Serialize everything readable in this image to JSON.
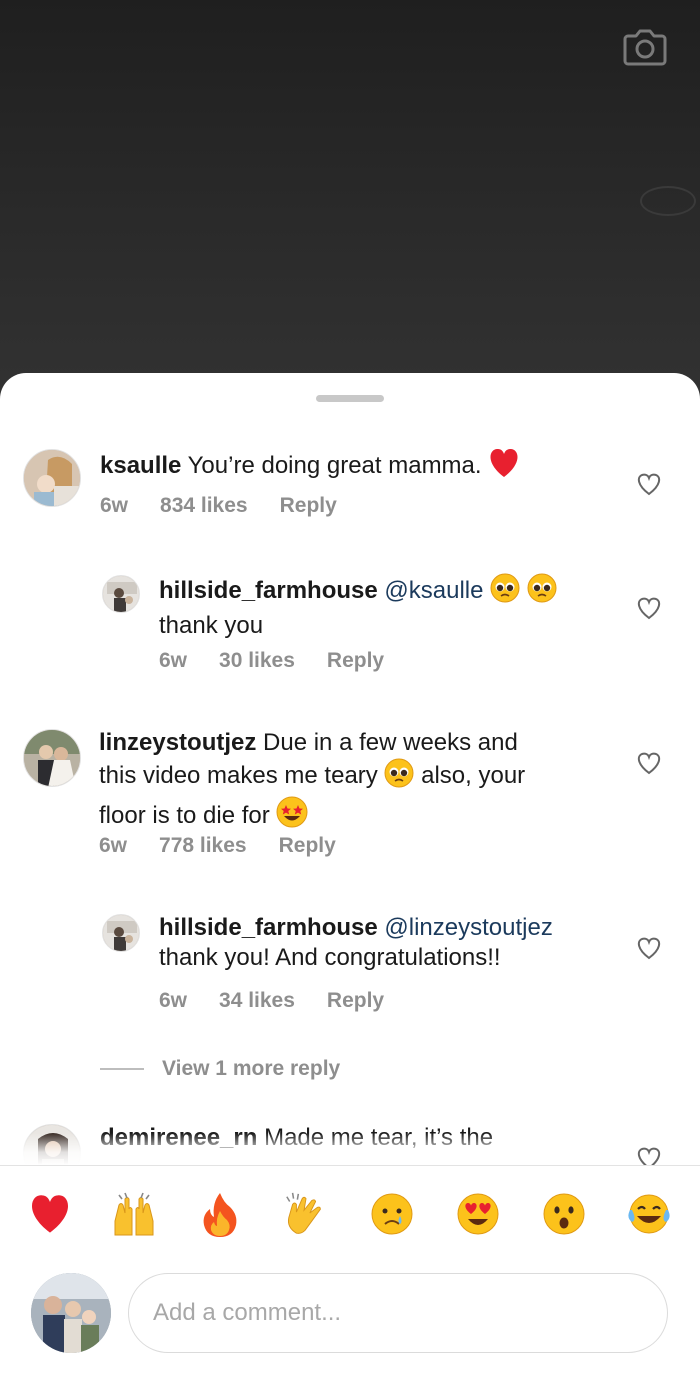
{
  "comments": [
    {
      "username": "ksaulle",
      "text": "You’re doing great mamma.",
      "time": "6w",
      "likes": "834 likes",
      "reply_label": "Reply",
      "emoji_end": "red-heart"
    },
    {
      "username": "hillside_farmhouse",
      "mention": "@ksaulle",
      "text_line2": "thank you",
      "time": "6w",
      "likes": "30 likes",
      "reply_label": "Reply"
    },
    {
      "username": "linzeystoutjez",
      "text_a": "Due in a few weeks and",
      "text_b": "this video makes me teary",
      "text_c": "also, your",
      "text_d": "floor is to die for",
      "time": "6w",
      "likes": "778 likes",
      "reply_label": "Reply"
    },
    {
      "username": "hillside_farmhouse",
      "mention": "@linzeystoutjez",
      "text_line2": "thank you! And congratulations!!",
      "time": "6w",
      "likes": "34 likes",
      "reply_label": "Reply"
    },
    {
      "username": "demirenee_rn",
      "text": "Made me tear, it’s the"
    }
  ],
  "view_more": "View 1 more reply",
  "reactions": [
    "red-heart-icon",
    "raised-hands-icon",
    "fire-icon",
    "clapping-hands-icon",
    "crying-face-icon",
    "heart-eyes-icon",
    "surprised-face-icon",
    "tears-of-joy-icon"
  ],
  "composer": {
    "placeholder": "Add a comment..."
  },
  "colors": {
    "mention": "#1b3a5c",
    "meta": "#8e8e8e",
    "heart": "#e8202f"
  }
}
